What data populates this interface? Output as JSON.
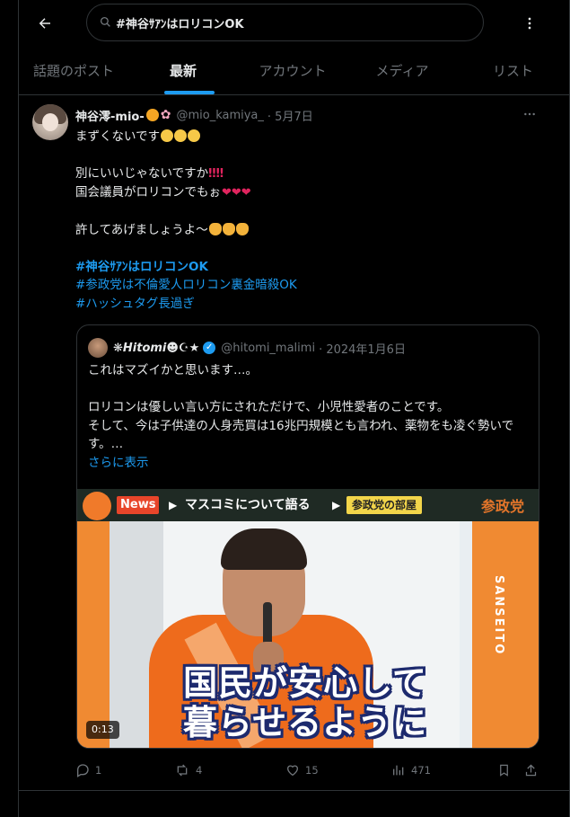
{
  "search": {
    "query": "#神谷ｻｱﾝはロリコンOK"
  },
  "tabs": [
    {
      "label": "話題のポスト"
    },
    {
      "label": "最新"
    },
    {
      "label": "アカウント"
    },
    {
      "label": "メディア"
    },
    {
      "label": "リスト"
    }
  ],
  "active_tab": "最新",
  "tweet": {
    "author_name": "神谷澪-mio-",
    "handle": "@mio_kamiya_",
    "date": "· 5月7日",
    "lines": {
      "l1": "まずくないです",
      "l2": "別にいいじゃないですか",
      "l3": "国会議員がロリコンでもぉ",
      "l4": "許してあげましょうよ〜"
    },
    "hashtags": [
      "#神谷ｻｱﾝはロリコンOK",
      "#参政党は不倫愛人ロリコン裏金暗殺OK",
      "#ハッシュタグ長過ぎ"
    ],
    "quote": {
      "author_name": "❋Hitomi☻☪★",
      "handle": "@hitomi_malimi",
      "date": "· 2024年1月6日",
      "line1": "これはマズイかと思います…。",
      "line2": "ロリコンは優しい言い方にされただけで、小児性愛者のことです。",
      "line3": "そして、今は子供達の人身売買は16兆円規模とも言われ、薬物をも凌ぐ勢いです。…",
      "show_more": "さらに表示",
      "video": {
        "news_label": "News",
        "banner_title": "マスコミについて語る",
        "banner_tag": "参政党の部屋",
        "party": "参政党",
        "sign_text": "SANSEITO",
        "subtitle_line1": "国民が安心して",
        "subtitle_line2": "暮らせるように",
        "duration": "0:13"
      }
    },
    "stats": {
      "replies": "1",
      "reposts": "4",
      "likes": "15",
      "views": "471"
    }
  },
  "colors": {
    "accent": "#1d9bf0",
    "background": "#000000",
    "muted": "#71767b",
    "border": "#2f3336"
  }
}
